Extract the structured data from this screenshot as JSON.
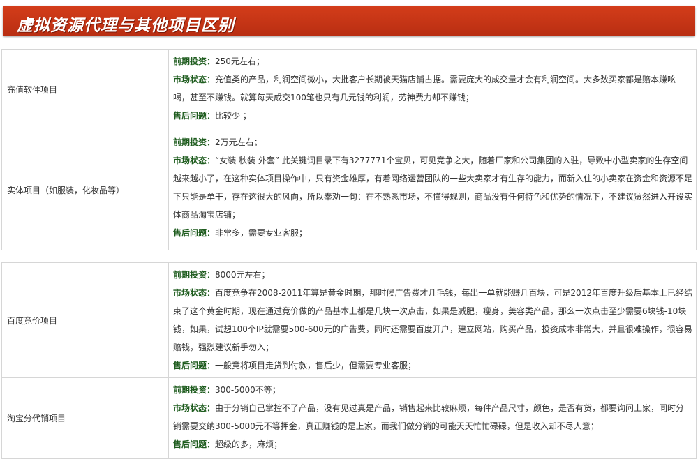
{
  "title": "虚拟资源代理与其他项目区别",
  "labels": {
    "invest": "前期投资：",
    "market": "市场状态：",
    "after": "售后问题："
  },
  "rows": [
    {
      "name": "充值软件项目",
      "invest": "250元左右；",
      "market": "充值类的产品，利润空间微小，大批客户长期被天猫店铺占据。需要庞大的成交量才会有利润空间。大多数买家都是赔本赚吆喝，甚至不赚钱。就算每天成交100笔也只有几元钱的利润，劳神费力却不赚钱；",
      "after": "比较少 ；"
    },
    {
      "name": "实体项目（如服装，化妆品等）",
      "invest": "2万元左右；",
      "market": "“女装 秋装 外套” 此关键词目录下有3277771个宝贝，可见竞争之大，随着厂家和公司集团的入驻，导致中小型卖家的生存空间越来越小了，在这种实体项目操作中，只有资金雄厚，有着网络运营团队的一些大卖家才有生存的能力，而新入住的小卖家在资金和资源不足下只能是单干，存在这很大的风向，所以奉劝一句：在不熟悉市场，不懂得规则，商品没有任何特色和优势的情况下，不建议贸然进入开设实体商品淘宝店铺；",
      "after": "非常多，需要专业客服；"
    },
    {
      "name": "百度竞价项目",
      "invest": "8000元左右；",
      "market": "百度竞争在2008-2011年算是黄金时期，那时候广告费才几毛钱，每出一单就能赚几百块，可是2012年百度升级后基本上已经结束了这个黄金时期，现在通过竞价做的产品基本上都是几块一次点击，如果是减肥，瘦身，美容类产品，那么一次点击至少需要6块钱-10块钱，如果，试想100个IP就需要500-600元的广告费，同时还需要百度开户，建立网站，购买产品，投资成本非常大，并且很难操作，很容易赔钱，强烈建议新手勿入；",
      "after": "一般竞将项目走货到付款，售后少，但需要专业客服；"
    },
    {
      "name": "淘宝分代销项目",
      "invest": "300-5000不等；",
      "market": "由于分销自己掌控不了产品，没有见过真是产品，销售起来比较麻烦，每件产品尺寸，颜色，是否有货，都要询问上家，同时分销需要交纳300-5000元不等押金，真正赚钱的是上家，而我们做分销的可能天天忙忙碌碌，但是收入却不尽人意；",
      "after": "超级的多，麻烦；"
    }
  ]
}
